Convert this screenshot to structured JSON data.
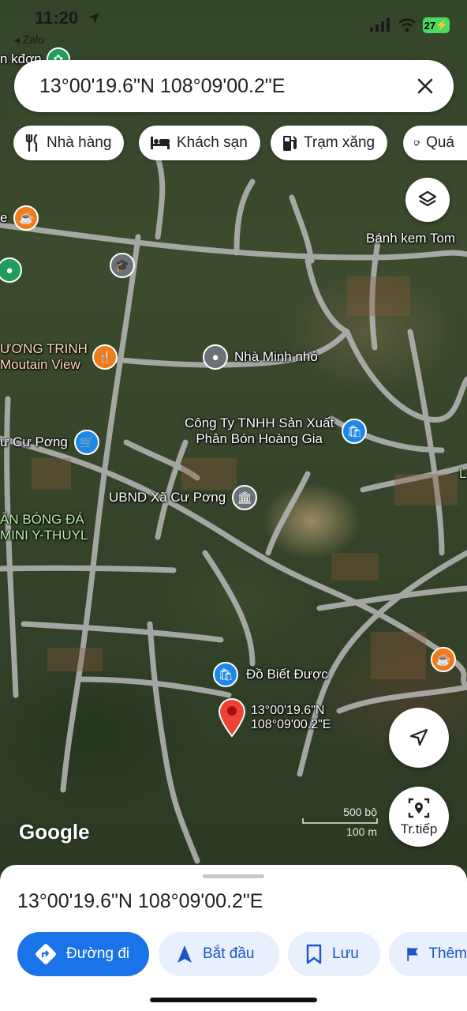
{
  "status_bar": {
    "time": "11:20",
    "back_app": "◂ Zalo",
    "battery": "27"
  },
  "search": {
    "value": "13°00'19.6\"N 108°09'00.2\"E"
  },
  "chips": [
    {
      "label": "Nhà hàng",
      "icon": "restaurant-icon"
    },
    {
      "label": "Khách sạn",
      "icon": "hotel-icon"
    },
    {
      "label": "Trạm xăng",
      "icon": "gas-station-icon"
    },
    {
      "label": "Quá",
      "icon": "cafe-icon"
    }
  ],
  "map": {
    "labels": {
      "top_left_partial": "n kđơn",
      "cafe_left": "e",
      "banh_kem": "Bánh kem Tom",
      "restaurant_line1": "ƯƠNG TRINH",
      "restaurant_line2": "Moutain View",
      "nha_minh_nho": "Nhà Minh nhỏ",
      "company_line1": "Công Ty TNHH Sản Xuất",
      "company_line2": "Phân Bón Hoàng Gia",
      "cu_pong_shop": "ư Cư Pơng",
      "ubnd": "UBND Xã Cư Pơng",
      "football_line1": "ÂN BÓNG ĐÁ",
      "football_line2": "MINI Y-THUYL",
      "right_edge": "L",
      "do_biet_duoc": "Đồ Biết Được",
      "pin_line1": "13°00'19.6\"N",
      "pin_line2": "108°09'00.2\"E"
    },
    "google": "Google",
    "scale_ft": "500 bộ",
    "scale_m": "100 m",
    "live_view_label": "Tr.tiếp"
  },
  "sheet": {
    "coords": "13°00'19.6\"N 108°09'00.2\"E",
    "actions": [
      {
        "label": "Đường đi",
        "icon": "directions-icon"
      },
      {
        "label": "Bắt đầu",
        "icon": "navigation-arrow-icon"
      },
      {
        "label": "Lưu",
        "icon": "bookmark-icon"
      },
      {
        "label": "Thêm",
        "icon": "flag-icon"
      }
    ]
  },
  "colors": {
    "accent": "#1a73e8",
    "pin_red": "#ea4335",
    "orange_poi": "#f07b1a",
    "blue_poi": "#1e88e5",
    "grey_poi": "#6b7177",
    "green_poi": "#1e9e5a"
  }
}
